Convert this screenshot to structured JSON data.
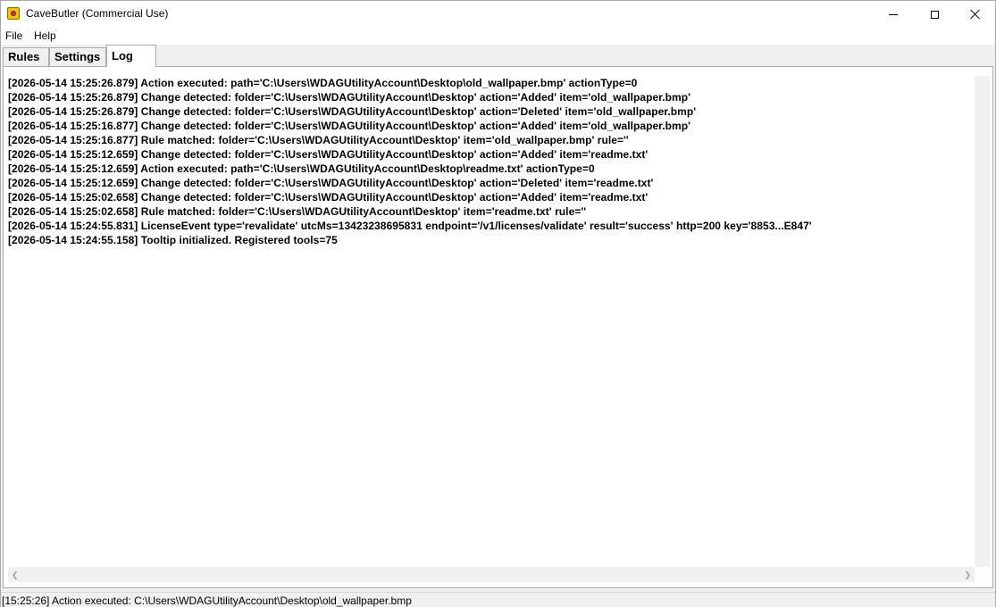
{
  "window": {
    "title": "CaveButler (Commercial Use)",
    "icon": "cavebutler-app-icon"
  },
  "menu": {
    "file": "File",
    "help": "Help"
  },
  "tabs": [
    {
      "label": "Rules",
      "selected": false
    },
    {
      "label": "Settings",
      "selected": false
    },
    {
      "label": "Log",
      "selected": true
    }
  ],
  "log": {
    "lines": [
      "[2026-05-14 15:25:26.879] Action executed: path='C:\\Users\\WDAGUtilityAccount\\Desktop\\old_wallpaper.bmp' actionType=0",
      "[2026-05-14 15:25:26.879] Change detected: folder='C:\\Users\\WDAGUtilityAccount\\Desktop' action='Added' item='old_wallpaper.bmp'",
      "[2026-05-14 15:25:26.879] Change detected: folder='C:\\Users\\WDAGUtilityAccount\\Desktop' action='Deleted' item='old_wallpaper.bmp'",
      "[2026-05-14 15:25:16.877] Change detected: folder='C:\\Users\\WDAGUtilityAccount\\Desktop' action='Added' item='old_wallpaper.bmp'",
      "[2026-05-14 15:25:16.877] Rule matched: folder='C:\\Users\\WDAGUtilityAccount\\Desktop' item='old_wallpaper.bmp' rule=''",
      "[2026-05-14 15:25:12.659] Change detected: folder='C:\\Users\\WDAGUtilityAccount\\Desktop' action='Added' item='readme.txt'",
      "[2026-05-14 15:25:12.659] Action executed: path='C:\\Users\\WDAGUtilityAccount\\Desktop\\readme.txt' actionType=0",
      "[2026-05-14 15:25:12.659] Change detected: folder='C:\\Users\\WDAGUtilityAccount\\Desktop' action='Deleted' item='readme.txt'",
      "[2026-05-14 15:25:02.658] Change detected: folder='C:\\Users\\WDAGUtilityAccount\\Desktop' action='Added' item='readme.txt'",
      "[2026-05-14 15:25:02.658] Rule matched: folder='C:\\Users\\WDAGUtilityAccount\\Desktop' item='readme.txt' rule=''",
      "[2026-05-14 15:24:55.831] LicenseEvent type='revalidate' utcMs=13423238695831 endpoint='/v1/licenses/validate' result='success' http=200 key='8853...E847'",
      "[2026-05-14 15:24:55.158] Tooltip initialized. Registered tools=75"
    ]
  },
  "statusbar": {
    "text": "[15:25:26] Action executed: C:\\Users\\WDAGUtilityAccount\\Desktop\\old_wallpaper.bmp"
  },
  "icons": {
    "minimize": "minimize-icon",
    "maximize": "maximize-icon",
    "close": "close-icon",
    "scroll_left": "chevron-left-icon",
    "scroll_right": "chevron-right-icon"
  }
}
